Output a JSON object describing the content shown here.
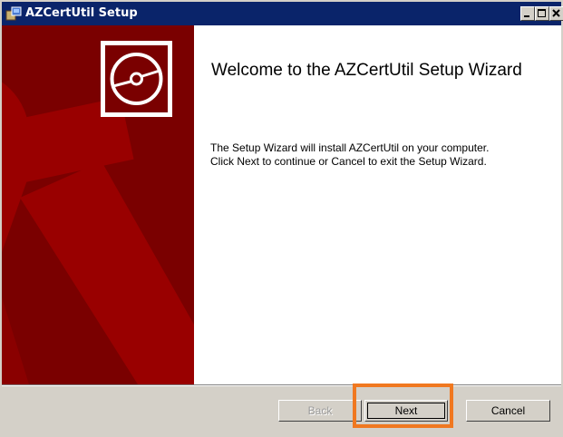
{
  "window": {
    "title": "AZCertUtil Setup",
    "app_icon": "installer-box-icon",
    "controls": [
      "minimize-icon",
      "maximize-icon",
      "close-icon"
    ]
  },
  "wizard": {
    "heading": "Welcome to the AZCertUtil Setup Wizard",
    "description_lines": [
      "The Setup Wizard will install AZCertUtil on your computer.",
      "Click Next to continue or Cancel to exit the Setup Wizard."
    ],
    "side_panel_logo": "cd-disc-icon"
  },
  "buttons": {
    "back": {
      "label": "Back",
      "enabled": false
    },
    "next": {
      "label": "Next",
      "enabled": true,
      "focused": true
    },
    "cancel": {
      "label": "Cancel",
      "enabled": true
    }
  },
  "colors": {
    "titlebar": "#0a246a",
    "side_panel_dark": "#7a0000",
    "side_panel_light": "#990000",
    "highlight": "#f07820"
  }
}
